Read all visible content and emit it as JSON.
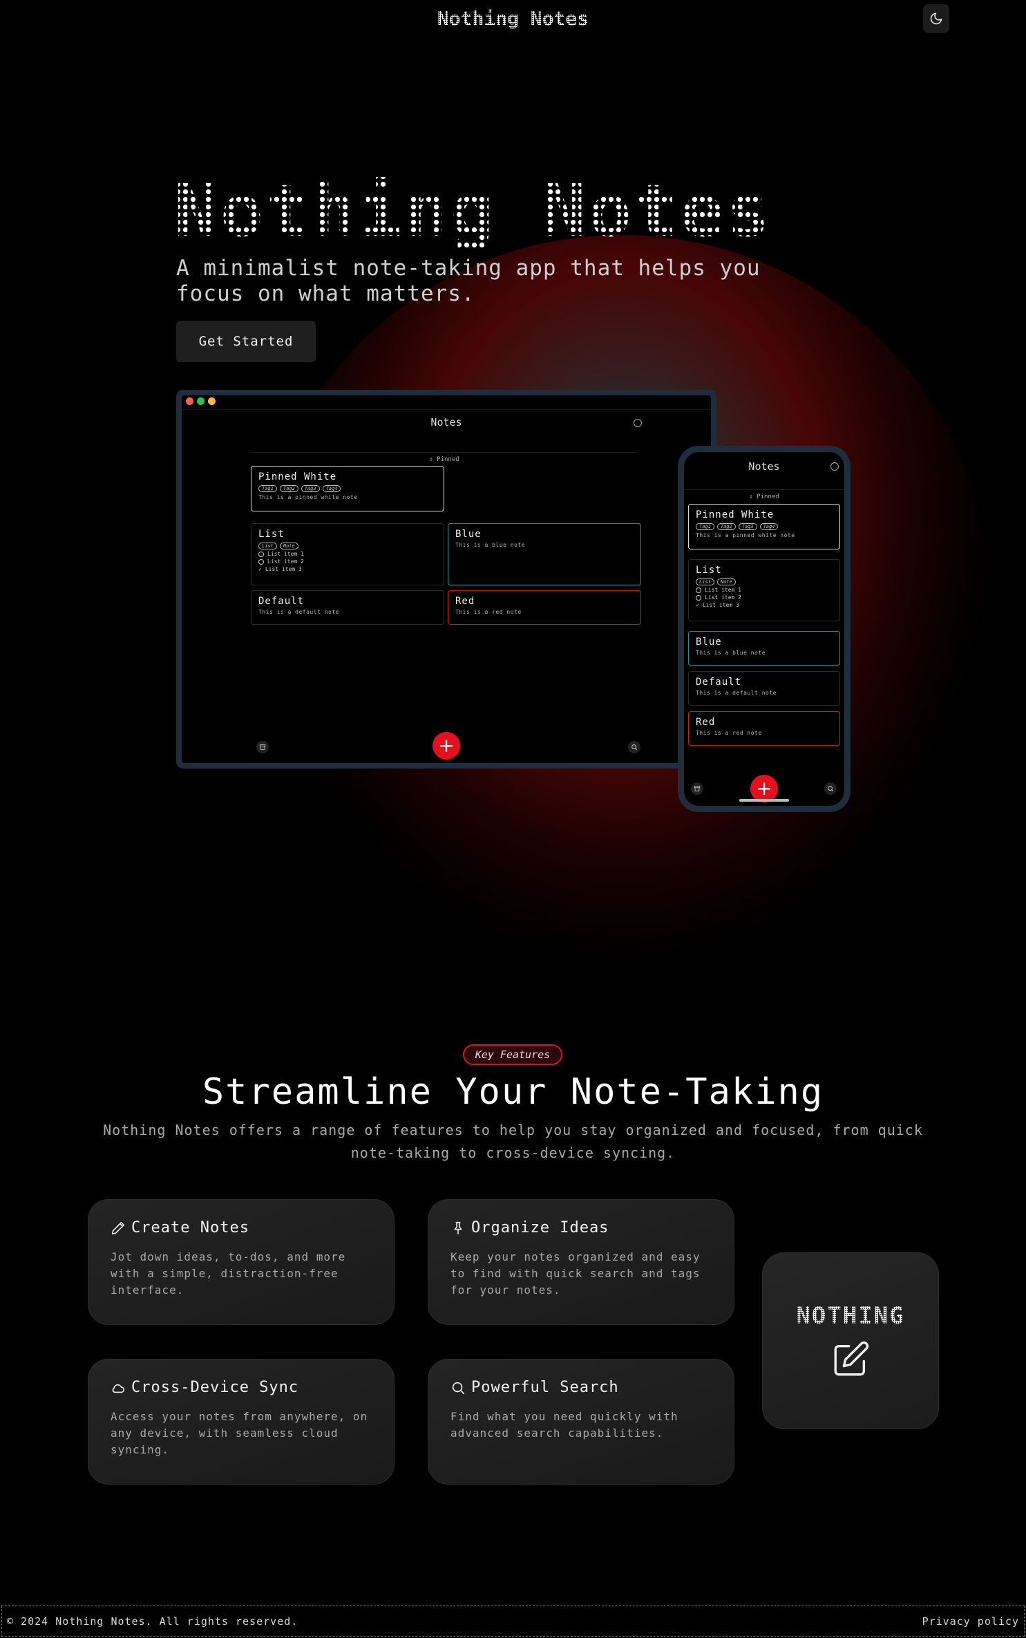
{
  "header": {
    "brand": "Nothing Notes",
    "theme_icon": "moon-icon"
  },
  "hero": {
    "title": "Nothing Notes",
    "subtitle": "A minimalist note-taking app that helps you focus on what matters.",
    "cta_label": "Get Started"
  },
  "mockup": {
    "app_title": "Notes",
    "pinned_label": "⇕ Pinned",
    "add_symbol": "+",
    "notes": {
      "pinned": {
        "title": "Pinned White",
        "tags": [
          "Tag1",
          "Tag2",
          "Tag3",
          "Tag4"
        ],
        "body": "This is a pinned white note"
      },
      "list": {
        "title": "List",
        "tags": [
          "List",
          "Note"
        ],
        "items": [
          "List item 1",
          "List item 2",
          "List item 3"
        ]
      },
      "blue": {
        "title": "Blue",
        "body": "This is a blue note"
      },
      "default": {
        "title": "Default",
        "body": "This is a default note"
      },
      "red": {
        "title": "Red",
        "body": "This is a red note"
      }
    },
    "colors": {
      "blue_border": "#1f8f8f",
      "red_border": "#d11a22",
      "accent": "#e5101d"
    }
  },
  "features": {
    "badge": "Key Features",
    "title": "Streamline Your Note-Taking",
    "subtitle": "Nothing Notes offers a range of features to help you stay organized and focused, from quick note-taking to cross-device syncing.",
    "cards": [
      {
        "icon": "pencil-icon",
        "title": "Create Notes",
        "desc": "Jot down ideas, to-dos, and more with a simple, distraction-free interface."
      },
      {
        "icon": "pin-icon",
        "title": "Organize Ideas",
        "desc": "Keep your notes organized and easy to find with quick search and tags for your notes."
      },
      {
        "icon": "cloud-icon",
        "title": "Cross-Device Sync",
        "desc": "Access your notes from anywhere, on any device, with seamless cloud syncing."
      },
      {
        "icon": "search-icon",
        "title": "Powerful Search",
        "desc": "Find what you need quickly with advanced search capabilities."
      }
    ],
    "logo_word": "NOTHING"
  },
  "footer": {
    "copyright": "© 2024 Nothing Notes. All rights reserved.",
    "privacy": "Privacy policy"
  }
}
